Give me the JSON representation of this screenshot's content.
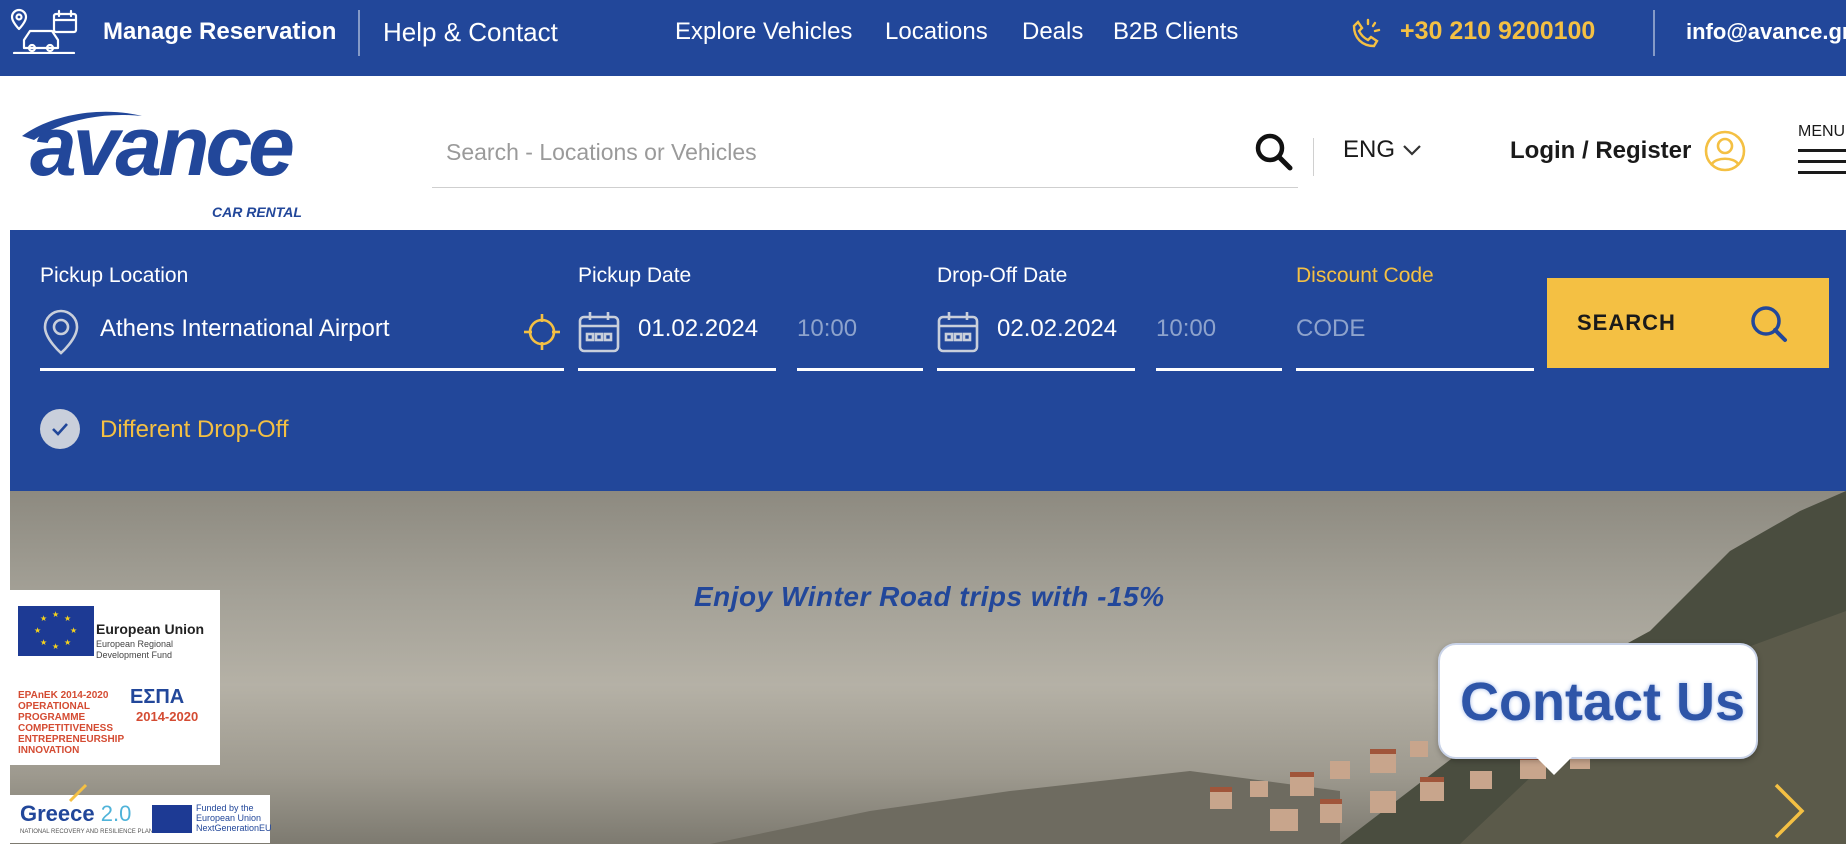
{
  "topbar": {
    "manage_reservation": "Manage Reservation",
    "help_contact": "Help & Contact",
    "nav": [
      "Explore Vehicles",
      "Locations",
      "Deals",
      "B2B Clients"
    ],
    "phone": "+30 210 9200100",
    "email": "info@avance.gr"
  },
  "header": {
    "logo_text": "avance",
    "logo_sub": "CAR RENTAL",
    "search_placeholder": "Search - Locations or Vehicles",
    "language": "ENG",
    "login": "Login / Register",
    "menu": "MENU"
  },
  "booking": {
    "pickup_location_label": "Pickup Location",
    "pickup_location_value": "Athens International Airport",
    "pickup_date_label": "Pickup Date",
    "pickup_date_value": "01.02.2024",
    "pickup_time_value": "10:00",
    "dropoff_date_label": "Drop-Off Date",
    "dropoff_date_value": "02.02.2024",
    "dropoff_time_value": "10:00",
    "discount_label": "Discount Code",
    "discount_placeholder": "CODE",
    "search_button": "SEARCH",
    "different_dropoff": "Different Drop-Off"
  },
  "hero": {
    "promo": "Enjoy Winter Road trips with -15%",
    "contact_us": "Contact Us",
    "eu_title": "European Union",
    "eu_sub": "European Regional Development Fund",
    "epanek": "EPAnEK 2014-2020 OPERATIONAL PROGRAMME COMPETITIVENESS ENTREPRENEURSHIP INNOVATION",
    "espa": "ΕΣΠΑ",
    "espa_years": "2014-2020",
    "greece": "Greece",
    "greece_version": "2.0",
    "greece_sub": "NATIONAL RECOVERY AND RESILIENCE PLAN",
    "funded_by": "Funded by the European Union NextGenerationEU"
  },
  "colors": {
    "brand_blue": "#22479a",
    "accent_yellow": "#f4c043"
  }
}
